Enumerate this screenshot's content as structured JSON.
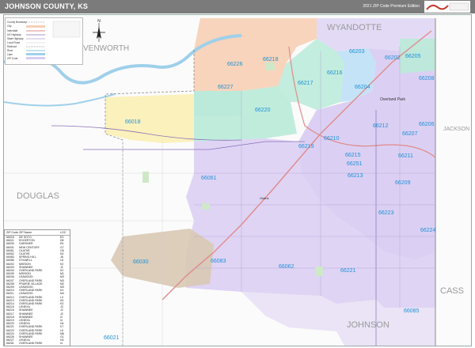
{
  "header": {
    "title": "JOHNSON COUNTY, KS",
    "edition": "2021 ZIP Code Premium Edition"
  },
  "colors": {
    "header_bg": "#7b7b7b",
    "zip_label": "#1e90d8",
    "county_label": "#9a9a9a",
    "zone_peach": "#f6cfb4",
    "zone_green": "#b9ead8",
    "zone_purple": "#d9cdf2",
    "zone_yellow": "#fbf0b8",
    "zone_tan": "#d8c9b4",
    "zone_blue": "#bfe0f6",
    "road_major": "#8a6fb8",
    "highway": "#e08a8a",
    "water": "#9fd0ea"
  },
  "counties": {
    "wyandotte": "WYANDOTTE",
    "leavenworth": "VENWORTH",
    "douglas": "DOUGLAS",
    "jackson": "JACKSON",
    "cass": "CASS",
    "johnson": "JOHNSON"
  },
  "cities": {
    "overland_park": "Overland Park",
    "olathe": "Olathe"
  },
  "compass": {
    "n": "N"
  },
  "zips": [
    "66218",
    "66203",
    "66202",
    "66205",
    "66226",
    "66216",
    "66217",
    "66227",
    "66204",
    "66208",
    "66220",
    "66212",
    "66206",
    "66210",
    "66207",
    "66211",
    "66018",
    "66219",
    "66215",
    "66251",
    "66213",
    "66061",
    "66209",
    "66223",
    "66224",
    "66062",
    "66221",
    "66030",
    "66083",
    "66085",
    "66021"
  ],
  "legend": {
    "items": [
      "County Boundary",
      "City",
      "Interstate",
      "US Highway",
      "State Highway",
      "Local Road",
      "Railroad",
      "River",
      "Lake",
      "ZIP Code"
    ]
  },
  "zip_table": {
    "headers": [
      "ZIP Code",
      "ZIP Name",
      "LOC"
    ],
    "rows": [
      [
        "66018",
        "DE SOTO",
        "E3"
      ],
      [
        "66021",
        "EDGERTON",
        "D8"
      ],
      [
        "66030",
        "GARDNER",
        "E6"
      ],
      [
        "66031",
        "NEW CENTURY",
        "G7"
      ],
      [
        "66061",
        "OLATHE",
        "G6"
      ],
      [
        "66062",
        "OLATHE",
        "K6"
      ],
      [
        "66083",
        "SPRING HILL",
        "J8"
      ],
      [
        "66085",
        "STILWELL",
        "L8"
      ],
      [
        "66202",
        "MISSION",
        "K2"
      ],
      [
        "66203",
        "SHAWNEE",
        "J2"
      ],
      [
        "66204",
        "OVERLAND PARK",
        "K2"
      ],
      [
        "66205",
        "MISSION",
        "M1"
      ],
      [
        "66206",
        "LEAWOOD",
        "M3"
      ],
      [
        "66207",
        "OVERLAND PARK",
        "M3"
      ],
      [
        "66208",
        "PRAIRIE VILLAGE",
        "M2"
      ],
      [
        "66209",
        "LEAWOOD",
        "M3"
      ],
      [
        "66210",
        "OVERLAND PARK",
        "K4"
      ],
      [
        "66211",
        "LEAWOOD",
        "M4"
      ],
      [
        "66212",
        "OVERLAND PARK",
        "L3"
      ],
      [
        "66213",
        "OVERLAND PARK",
        "K5"
      ],
      [
        "66214",
        "OVERLAND PARK",
        "K3"
      ],
      [
        "66215",
        "LENEXA",
        "J3"
      ],
      [
        "66216",
        "SHAWNEE",
        "J2"
      ],
      [
        "66217",
        "SHAWNEE",
        "J2"
      ],
      [
        "66218",
        "SHAWNEE",
        "I2"
      ],
      [
        "66219",
        "LENEXA",
        "I4"
      ],
      [
        "66220",
        "LENEXA",
        "H4"
      ],
      [
        "66221",
        "OVERLAND PARK",
        "K7"
      ],
      [
        "66223",
        "OVERLAND PARK",
        "L6"
      ],
      [
        "66224",
        "OVERLAND PARK",
        "M6"
      ],
      [
        "66226",
        "SHAWNEE",
        "G1"
      ],
      [
        "66227",
        "LENEXA",
        "H3"
      ],
      [
        "66251",
        "OVERLAND PARK",
        "I4"
      ]
    ]
  }
}
